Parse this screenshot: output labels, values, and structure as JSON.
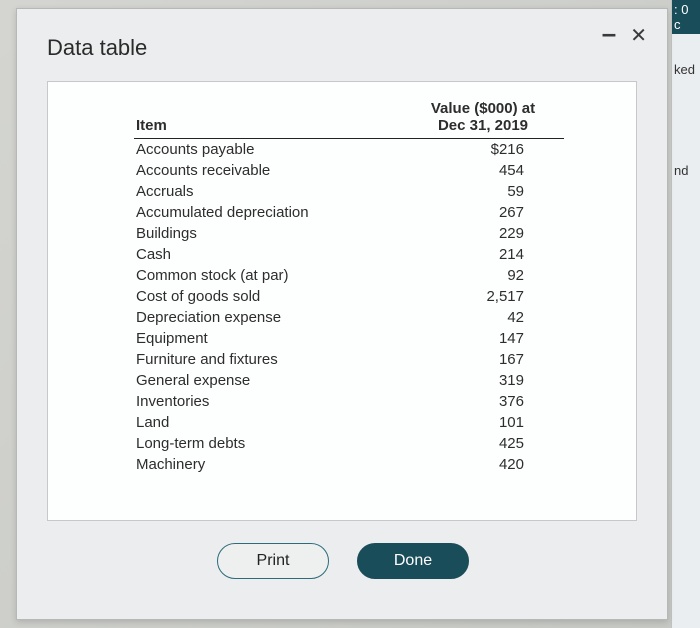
{
  "sideStrip": {
    "top": ": 0 c",
    "line1": "ked",
    "line2": "nd"
  },
  "dialog": {
    "title": "Data table",
    "minimize": "–",
    "close": "✕"
  },
  "table": {
    "header_item": "Item",
    "header_value_line1": "Value ($000) at",
    "header_value_line2": "Dec 31, 2019",
    "rows": [
      {
        "label": "Accounts payable",
        "value": "$216"
      },
      {
        "label": "Accounts receivable",
        "value": "454"
      },
      {
        "label": "Accruals",
        "value": "59"
      },
      {
        "label": "Accumulated depreciation",
        "value": "267"
      },
      {
        "label": "Buildings",
        "value": "229"
      },
      {
        "label": "Cash",
        "value": "214"
      },
      {
        "label": "Common stock (at par)",
        "value": "92"
      },
      {
        "label": "Cost of goods sold",
        "value": "2,517"
      },
      {
        "label": "Depreciation expense",
        "value": "42"
      },
      {
        "label": "Equipment",
        "value": "147"
      },
      {
        "label": "Furniture and fixtures",
        "value": "167"
      },
      {
        "label": "General expense",
        "value": "319"
      },
      {
        "label": "Inventories",
        "value": "376"
      },
      {
        "label": "Land",
        "value": "101"
      },
      {
        "label": "Long-term debts",
        "value": "425"
      },
      {
        "label": "Machinery",
        "value": "420"
      }
    ]
  },
  "buttons": {
    "print": "Print",
    "done": "Done"
  }
}
